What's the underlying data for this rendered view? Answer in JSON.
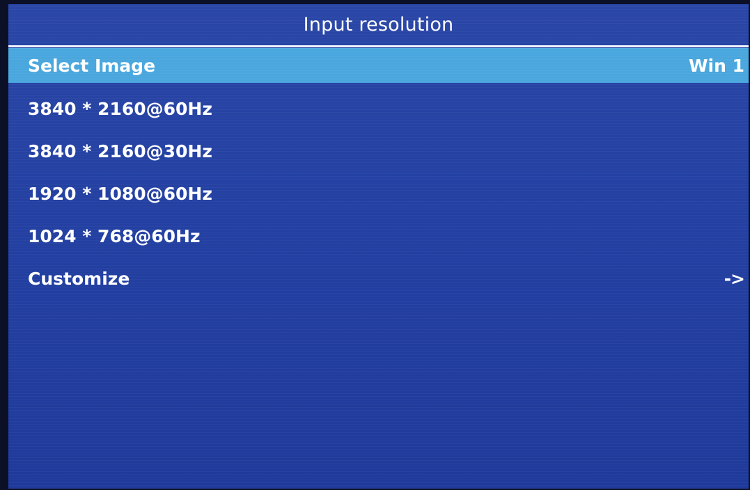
{
  "title": "Input resolution",
  "menu": {
    "select_image": {
      "label": "Select Image",
      "value": "Win 1"
    },
    "resolutions": [
      "3840 * 2160@60Hz",
      "3840 * 2160@30Hz",
      "1920 * 1080@60Hz",
      "1024 * 768@60Hz"
    ],
    "customize": {
      "label": "Customize",
      "arrow": "->"
    }
  },
  "colors": {
    "background": "#2340a2",
    "highlight": "#4aa7de",
    "text": "#ffffff",
    "divider": "#eef2ff"
  }
}
